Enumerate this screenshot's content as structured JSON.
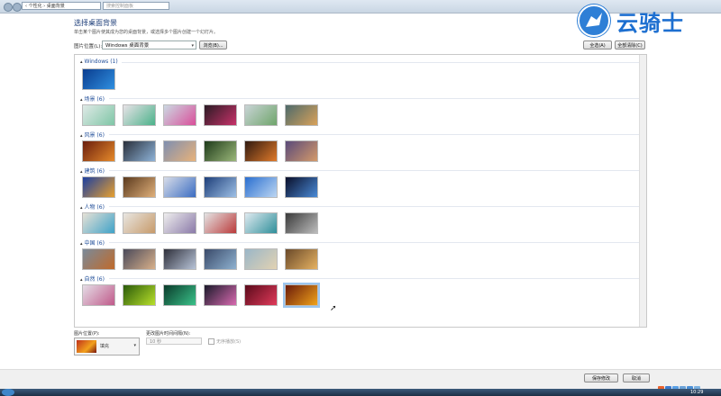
{
  "address": {
    "path": "‹ 个性化 › 桌面背景",
    "search_placeholder": "搜索控制面板"
  },
  "brand": {
    "logo_text": "云骑士"
  },
  "header": {
    "title": "选择桌面背景",
    "subtitle": "单击某个图片使其成为您的桌面背景，或选择多个图片创建一个幻灯片。"
  },
  "location": {
    "label": "图片位置(L):",
    "value": "Windows 桌面背景",
    "browse_label": "浏览(B)..."
  },
  "actions": {
    "select_all_label": "全选(A)",
    "clear_all_label": "全部清除(C)"
  },
  "groups": [
    {
      "label": "Windows (1)",
      "thumbs": [
        [
          "#0a3d8f",
          "#2f8fe0"
        ]
      ]
    },
    {
      "label": "场景 (6)",
      "thumbs": [
        [
          "#dfe9e6",
          "#7fc6a6"
        ],
        [
          "#e8e2e7",
          "#4bb28a"
        ],
        [
          "#cbd9e2",
          "#d94f9a"
        ],
        [
          "#2a1b24",
          "#c8326a"
        ],
        [
          "#c9d4d6",
          "#6fa56b"
        ],
        [
          "#4d6a6b",
          "#d9a25a"
        ]
      ]
    },
    {
      "label": "风景 (6)",
      "thumbs": [
        [
          "#6a1e0e",
          "#e68a2a"
        ],
        [
          "#2a2f3a",
          "#8eb3d8"
        ],
        [
          "#7f8fb0",
          "#e8b27a"
        ],
        [
          "#1e3a1a",
          "#9bb87a"
        ],
        [
          "#301a10",
          "#e07a2a"
        ],
        [
          "#5a4a7a",
          "#d49a6a"
        ]
      ]
    },
    {
      "label": "建筑 (6)",
      "thumbs": [
        [
          "#1b3fa0",
          "#e8a02e"
        ],
        [
          "#5b3a1e",
          "#e0b07a"
        ],
        [
          "#d8dde8",
          "#3b6cc2"
        ],
        [
          "#1e3f7a",
          "#9ec0e6"
        ],
        [
          "#2a6fd0",
          "#bcd6f2"
        ],
        [
          "#0a0f2a",
          "#4a8ad6"
        ]
      ]
    },
    {
      "label": "人物 (6)",
      "thumbs": [
        [
          "#e6e1d6",
          "#3fa2c8"
        ],
        [
          "#e8e6e2",
          "#c79a6a"
        ],
        [
          "#efeeee",
          "#8a7aa8"
        ],
        [
          "#e4e4e4",
          "#bb3a3a"
        ],
        [
          "#dfeaf0",
          "#2f8f9a"
        ],
        [
          "#3a3a3a",
          "#bdbdbd"
        ]
      ]
    },
    {
      "label": "中国 (6)",
      "thumbs": [
        [
          "#7a8a9a",
          "#c06a2a"
        ],
        [
          "#4a4a5a",
          "#d8b08a"
        ],
        [
          "#2e2f3a",
          "#b8c4d8"
        ],
        [
          "#3a4a6a",
          "#8fb2d0"
        ],
        [
          "#9ab6c8",
          "#e2d2b2"
        ],
        [
          "#6a4a2a",
          "#e6b262"
        ]
      ]
    },
    {
      "label": "自然 (6)",
      "thumbs": [
        [
          "#e4dde6",
          "#c05a8a"
        ],
        [
          "#2a5a0a",
          "#b8e02a"
        ],
        [
          "#0a3a2a",
          "#3ac28a"
        ],
        [
          "#1a1a2a",
          "#d86ab0"
        ],
        [
          "#5a0a1a",
          "#e03a5a"
        ],
        [
          "#6a1a0a",
          "#f0a21a"
        ]
      ]
    }
  ],
  "position": {
    "label": "图片位置(P):",
    "value": "填充"
  },
  "interval": {
    "label": "更改图片时间间隔(N):",
    "value": "10 秒",
    "shuffle_label": "无序播放(S)"
  },
  "footer": {
    "save_label": "保存修改",
    "cancel_label": "取消"
  },
  "taskbar": {
    "clock": "10:29"
  }
}
